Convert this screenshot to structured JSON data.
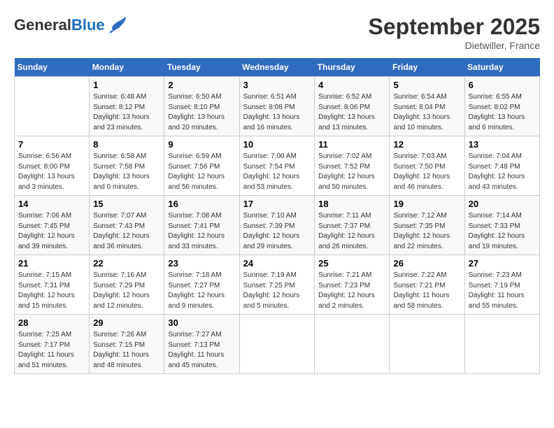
{
  "header": {
    "logo_general": "General",
    "logo_blue": "Blue",
    "month_title": "September 2025",
    "location": "Dietwiller, France"
  },
  "days_of_week": [
    "Sunday",
    "Monday",
    "Tuesday",
    "Wednesday",
    "Thursday",
    "Friday",
    "Saturday"
  ],
  "weeks": [
    [
      {
        "num": "",
        "info": ""
      },
      {
        "num": "1",
        "info": "Sunrise: 6:48 AM\nSunset: 8:12 PM\nDaylight: 13 hours\nand 23 minutes."
      },
      {
        "num": "2",
        "info": "Sunrise: 6:50 AM\nSunset: 8:10 PM\nDaylight: 13 hours\nand 20 minutes."
      },
      {
        "num": "3",
        "info": "Sunrise: 6:51 AM\nSunset: 8:08 PM\nDaylight: 13 hours\nand 16 minutes."
      },
      {
        "num": "4",
        "info": "Sunrise: 6:52 AM\nSunset: 8:06 PM\nDaylight: 13 hours\nand 13 minutes."
      },
      {
        "num": "5",
        "info": "Sunrise: 6:54 AM\nSunset: 8:04 PM\nDaylight: 13 hours\nand 10 minutes."
      },
      {
        "num": "6",
        "info": "Sunrise: 6:55 AM\nSunset: 8:02 PM\nDaylight: 13 hours\nand 6 minutes."
      }
    ],
    [
      {
        "num": "7",
        "info": "Sunrise: 6:56 AM\nSunset: 8:00 PM\nDaylight: 13 hours\nand 3 minutes."
      },
      {
        "num": "8",
        "info": "Sunrise: 6:58 AM\nSunset: 7:58 PM\nDaylight: 13 hours\nand 0 minutes."
      },
      {
        "num": "9",
        "info": "Sunrise: 6:59 AM\nSunset: 7:56 PM\nDaylight: 12 hours\nand 56 minutes."
      },
      {
        "num": "10",
        "info": "Sunrise: 7:00 AM\nSunset: 7:54 PM\nDaylight: 12 hours\nand 53 minutes."
      },
      {
        "num": "11",
        "info": "Sunrise: 7:02 AM\nSunset: 7:52 PM\nDaylight: 12 hours\nand 50 minutes."
      },
      {
        "num": "12",
        "info": "Sunrise: 7:03 AM\nSunset: 7:50 PM\nDaylight: 12 hours\nand 46 minutes."
      },
      {
        "num": "13",
        "info": "Sunrise: 7:04 AM\nSunset: 7:48 PM\nDaylight: 12 hours\nand 43 minutes."
      }
    ],
    [
      {
        "num": "14",
        "info": "Sunrise: 7:06 AM\nSunset: 7:45 PM\nDaylight: 12 hours\nand 39 minutes."
      },
      {
        "num": "15",
        "info": "Sunrise: 7:07 AM\nSunset: 7:43 PM\nDaylight: 12 hours\nand 36 minutes."
      },
      {
        "num": "16",
        "info": "Sunrise: 7:08 AM\nSunset: 7:41 PM\nDaylight: 12 hours\nand 33 minutes."
      },
      {
        "num": "17",
        "info": "Sunrise: 7:10 AM\nSunset: 7:39 PM\nDaylight: 12 hours\nand 29 minutes."
      },
      {
        "num": "18",
        "info": "Sunrise: 7:11 AM\nSunset: 7:37 PM\nDaylight: 12 hours\nand 26 minutes."
      },
      {
        "num": "19",
        "info": "Sunrise: 7:12 AM\nSunset: 7:35 PM\nDaylight: 12 hours\nand 22 minutes."
      },
      {
        "num": "20",
        "info": "Sunrise: 7:14 AM\nSunset: 7:33 PM\nDaylight: 12 hours\nand 19 minutes."
      }
    ],
    [
      {
        "num": "21",
        "info": "Sunrise: 7:15 AM\nSunset: 7:31 PM\nDaylight: 12 hours\nand 15 minutes."
      },
      {
        "num": "22",
        "info": "Sunrise: 7:16 AM\nSunset: 7:29 PM\nDaylight: 12 hours\nand 12 minutes."
      },
      {
        "num": "23",
        "info": "Sunrise: 7:18 AM\nSunset: 7:27 PM\nDaylight: 12 hours\nand 9 minutes."
      },
      {
        "num": "24",
        "info": "Sunrise: 7:19 AM\nSunset: 7:25 PM\nDaylight: 12 hours\nand 5 minutes."
      },
      {
        "num": "25",
        "info": "Sunrise: 7:21 AM\nSunset: 7:23 PM\nDaylight: 12 hours\nand 2 minutes."
      },
      {
        "num": "26",
        "info": "Sunrise: 7:22 AM\nSunset: 7:21 PM\nDaylight: 11 hours\nand 58 minutes."
      },
      {
        "num": "27",
        "info": "Sunrise: 7:23 AM\nSunset: 7:19 PM\nDaylight: 11 hours\nand 55 minutes."
      }
    ],
    [
      {
        "num": "28",
        "info": "Sunrise: 7:25 AM\nSunset: 7:17 PM\nDaylight: 11 hours\nand 51 minutes."
      },
      {
        "num": "29",
        "info": "Sunrise: 7:26 AM\nSunset: 7:15 PM\nDaylight: 11 hours\nand 48 minutes."
      },
      {
        "num": "30",
        "info": "Sunrise: 7:27 AM\nSunset: 7:13 PM\nDaylight: 11 hours\nand 45 minutes."
      },
      {
        "num": "",
        "info": ""
      },
      {
        "num": "",
        "info": ""
      },
      {
        "num": "",
        "info": ""
      },
      {
        "num": "",
        "info": ""
      }
    ]
  ]
}
